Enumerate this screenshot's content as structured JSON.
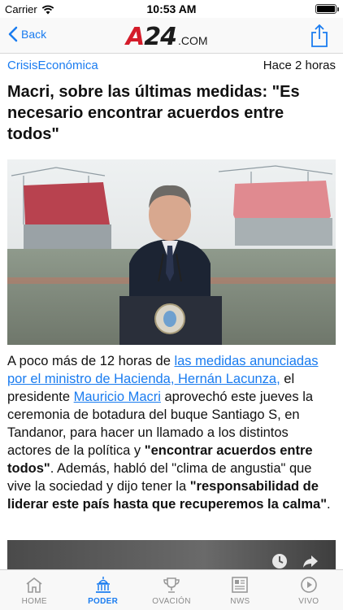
{
  "status_bar": {
    "carrier": "Carrier",
    "time": "10:53 AM",
    "battery_level": 1.0
  },
  "nav": {
    "back_label": "Back",
    "logo_text": "A24",
    "logo_suffix": ".COM",
    "share_icon": "share-icon"
  },
  "article": {
    "category": "CrisisEconómica",
    "time_ago": "Hace 2 horas",
    "headline": "Macri, sobre las últimas medidas: \"Es necesario encontrar acuerdos entre todos\"",
    "body": {
      "p1": "A poco más de 12 horas de ",
      "link1": "las medidas anunciadas por el ministro de Hacienda, Hernán Lacunza,",
      "p2": " el presidente ",
      "link2": "Mauricio Macri",
      "p3": " aprovechó este jueves la ceremonia de botadura del buque Santiago S, en Tandanor, para hacer un llamado a los distintos actores de la política y ",
      "bold1": "\"encontrar acuerdos entre todos\"",
      "p4": ". Además, habló del \"clima de angustia\" que vive la sociedad y dijo tener la ",
      "bold2": "\"responsabilidad de liderar este país hasta que recuperemos la calma\"",
      "p5": "."
    }
  },
  "tabs": [
    {
      "label": "HOME",
      "icon": "home-icon",
      "active": false
    },
    {
      "label": "PODER",
      "icon": "capitol-icon",
      "active": true
    },
    {
      "label": "OVACIÓN",
      "icon": "trophy-icon",
      "active": false
    },
    {
      "label": "NWS",
      "icon": "newspaper-icon",
      "active": false
    },
    {
      "label": "VIVO",
      "icon": "play-icon",
      "active": false
    }
  ],
  "colors": {
    "accent": "#1a7cf0",
    "brand_red": "#d41c2a"
  }
}
